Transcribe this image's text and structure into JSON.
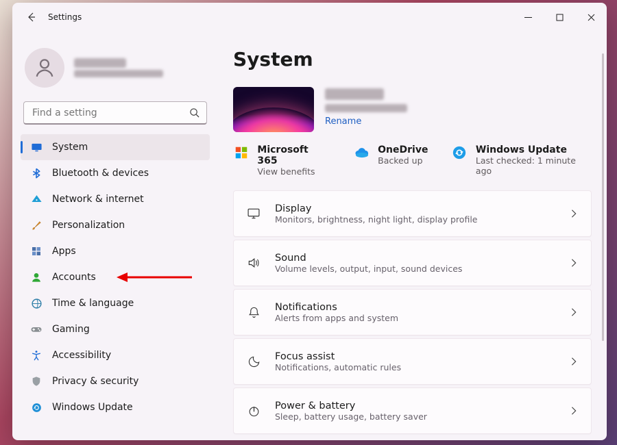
{
  "window": {
    "title": "Settings"
  },
  "profile": {
    "name": "████",
    "email": "████████"
  },
  "search": {
    "placeholder": "Find a setting"
  },
  "sidebar": {
    "items": [
      {
        "label": "System",
        "icon": "monitor-icon",
        "color": "#1f6cd6",
        "selected": true
      },
      {
        "label": "Bluetooth & devices",
        "icon": "bluetooth-icon",
        "color": "#1f6cd6"
      },
      {
        "label": "Network & internet",
        "icon": "wifi-icon",
        "color": "#1f9ed6"
      },
      {
        "label": "Personalization",
        "icon": "brush-icon",
        "color": "#d68a1f"
      },
      {
        "label": "Apps",
        "icon": "apps-icon",
        "color": "#4a6fa8"
      },
      {
        "label": "Accounts",
        "icon": "person-icon",
        "color": "#2fa836",
        "annotated": true
      },
      {
        "label": "Time & language",
        "icon": "globe-clock-icon",
        "color": "#2f7fa8"
      },
      {
        "label": "Gaming",
        "icon": "gamepad-icon",
        "color": "#7a7f83"
      },
      {
        "label": "Accessibility",
        "icon": "accessibility-icon",
        "color": "#1f6cd6"
      },
      {
        "label": "Privacy & security",
        "icon": "shield-icon",
        "color": "#8a8f93"
      },
      {
        "label": "Windows Update",
        "icon": "update-icon",
        "color": "#1f8fd6"
      }
    ]
  },
  "main": {
    "heading": "System",
    "device": {
      "name": "████",
      "model": "████████",
      "rename": "Rename"
    },
    "status": [
      {
        "icon": "ms365-icon",
        "title": "Microsoft 365",
        "sub": "View benefits"
      },
      {
        "icon": "onedrive-icon",
        "title": "OneDrive",
        "sub": "Backed up"
      },
      {
        "icon": "windows-update-icon",
        "title": "Windows Update",
        "sub": "Last checked: 1 minute ago"
      }
    ],
    "cards": [
      {
        "icon": "display-icon",
        "title": "Display",
        "sub": "Monitors, brightness, night light, display profile"
      },
      {
        "icon": "sound-icon",
        "title": "Sound",
        "sub": "Volume levels, output, input, sound devices"
      },
      {
        "icon": "notifications-icon",
        "title": "Notifications",
        "sub": "Alerts from apps and system"
      },
      {
        "icon": "focus-icon",
        "title": "Focus assist",
        "sub": "Notifications, automatic rules"
      },
      {
        "icon": "power-icon",
        "title": "Power & battery",
        "sub": "Sleep, battery usage, battery saver"
      }
    ]
  }
}
